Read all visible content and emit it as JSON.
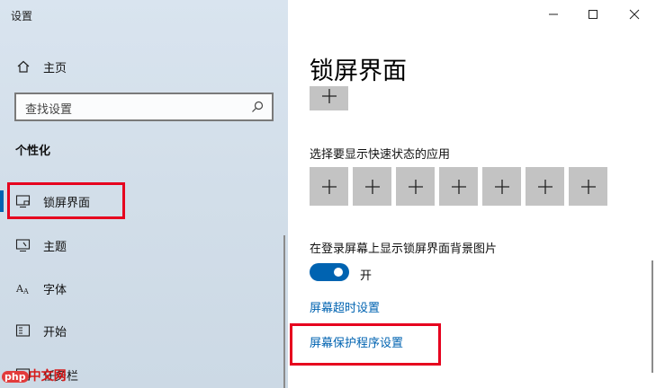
{
  "window": {
    "title": "设置",
    "controls": {
      "minimize": "minimize-icon",
      "maximize": "maximize-icon",
      "close": "close-icon"
    }
  },
  "sidebar": {
    "home": {
      "label": "主页",
      "icon": "home-icon"
    },
    "search": {
      "placeholder": "查找设置",
      "icon": "search-icon"
    },
    "section_title": "个性化",
    "items": [
      {
        "label": "锁屏界面",
        "icon": "lock-screen-icon",
        "active": true
      },
      {
        "label": "主题",
        "icon": "theme-icon"
      },
      {
        "label": "字体",
        "icon": "font-icon"
      },
      {
        "label": "开始",
        "icon": "start-icon"
      },
      {
        "label": "任务栏",
        "icon": "taskbar-icon"
      }
    ],
    "accent_color": "#0063b1"
  },
  "main": {
    "title": "锁屏界面",
    "quick_status_label": "选择要显示快速状态的应用",
    "quick_status_tiles": 7,
    "background_label": "在登录屏幕上显示锁屏界面背景图片",
    "toggle": {
      "state": "on",
      "label": "开"
    },
    "links": {
      "screen_timeout": "屏幕超时设置",
      "screen_saver": "屏幕保护程序设置"
    }
  },
  "watermark": {
    "brand": "php",
    "text": "中文网"
  },
  "annotation_color": "#e6001e"
}
